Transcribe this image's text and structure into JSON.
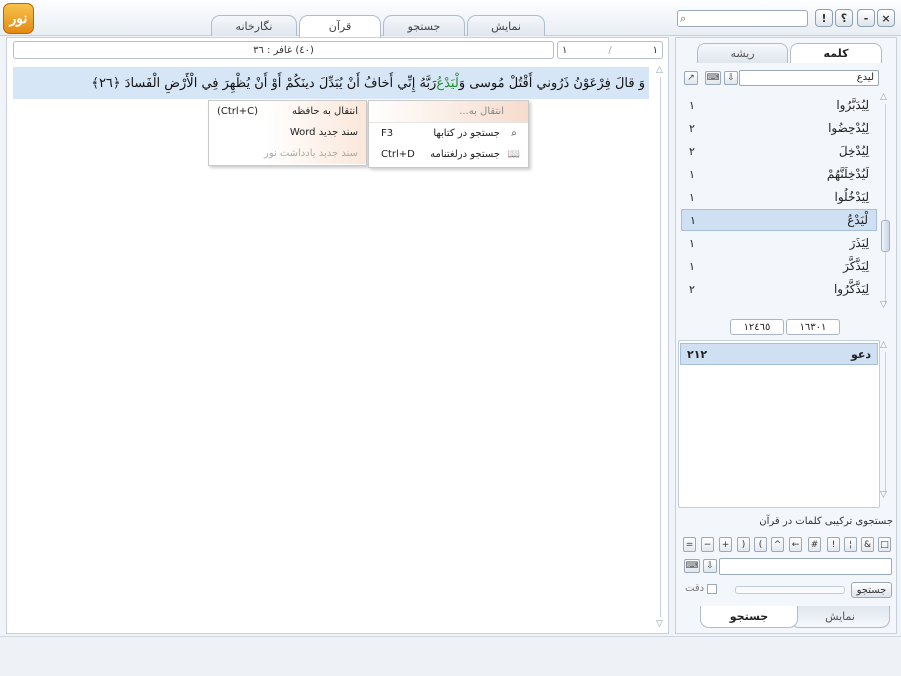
{
  "app": {
    "logo_text": "نور"
  },
  "main_tabs": [
    {
      "label": "نمایش"
    },
    {
      "label": "جستجو"
    },
    {
      "label": "قرآن"
    },
    {
      "label": "نگارخانه"
    }
  ],
  "top_search": {
    "placeholder": "",
    "value": ""
  },
  "window_buttons": [
    "!",
    "؟",
    "-",
    "×"
  ],
  "position": {
    "sura_info": "(٤٠) غافر : ٣٦",
    "field_a": "١",
    "field_b": "١"
  },
  "verse": {
    "before": "وَ قالَ فِرْعَوْنُ ذَرُوني‏ أَقْتُلْ مُوسى‏ وَ",
    "highlight": "لْيَدْعُ",
    "after": " رَبَّهُ إِنِّي أَخافُ أَنْ يُبَدِّلَ دينَكُمْ أَوْ أَنْ يُظْهِرَ فِي الْأَرْضِ الْفَسادَ",
    "number": "﴿٢٦﴾"
  },
  "context_menu_left": {
    "items": [
      {
        "label": "انتقال به حافظه",
        "shortcut": "(Ctrl+C)",
        "disabled": false
      },
      {
        "label": "سند جدید Word",
        "shortcut": "",
        "disabled": false
      },
      {
        "label": "سند جدید یادداشت نور",
        "shortcut": "",
        "disabled": true
      }
    ]
  },
  "context_menu_right": {
    "header": "انتقال به...",
    "items": [
      {
        "label": "جستجو در کتابها",
        "shortcut": "F3",
        "icon": "magnifier-icon"
      },
      {
        "label": "جستجو درلغتنامه",
        "shortcut": "Ctrl+D",
        "icon": "dictionary-icon"
      }
    ]
  },
  "right_panel": {
    "tabs": [
      {
        "label": "کلمه"
      },
      {
        "label": "ریشه"
      }
    ],
    "word_input": "لیدع",
    "words": [
      {
        "word": "لِيُدَبَّرُوا",
        "count": "١"
      },
      {
        "word": "لِيُدْحِضُوا",
        "count": "٢"
      },
      {
        "word": "لِيُدْخِلَ",
        "count": "٢"
      },
      {
        "word": "لَيُدْخِلَنَّهُمْ",
        "count": "١"
      },
      {
        "word": "لِيَدْخُلُوا",
        "count": "١"
      },
      {
        "word": "لْيَدْعُ",
        "count": "١",
        "selected": true
      },
      {
        "word": "لِيَذَرَ",
        "count": "١"
      },
      {
        "word": "لِيَذَّكَّرَ",
        "count": "١"
      },
      {
        "word": "لِيَذَّكَّرُوا",
        "count": "٢"
      }
    ],
    "counts": {
      "left": "١٢٤٦٥",
      "right": "١٦٣٠١"
    },
    "roots": [
      {
        "root": "دعو",
        "count": "٢١٢"
      }
    ],
    "combo_title": "جستجوی ترکیبی کلمات در قرآن",
    "symbols": [
      "□",
      "&",
      "¦",
      "!",
      "#",
      "←",
      "^",
      "(",
      ")",
      "+",
      "−",
      "="
    ],
    "search_button": "جستجو",
    "exact_label": "دقت",
    "bottom_tabs": [
      {
        "label": "نمایش"
      },
      {
        "label": "جستجو"
      }
    ]
  },
  "colors": {
    "accent": "#d6e6f7",
    "highlight_word": "#1f8e29",
    "selection": "#cfe0f3",
    "logo": "#e48a12"
  }
}
